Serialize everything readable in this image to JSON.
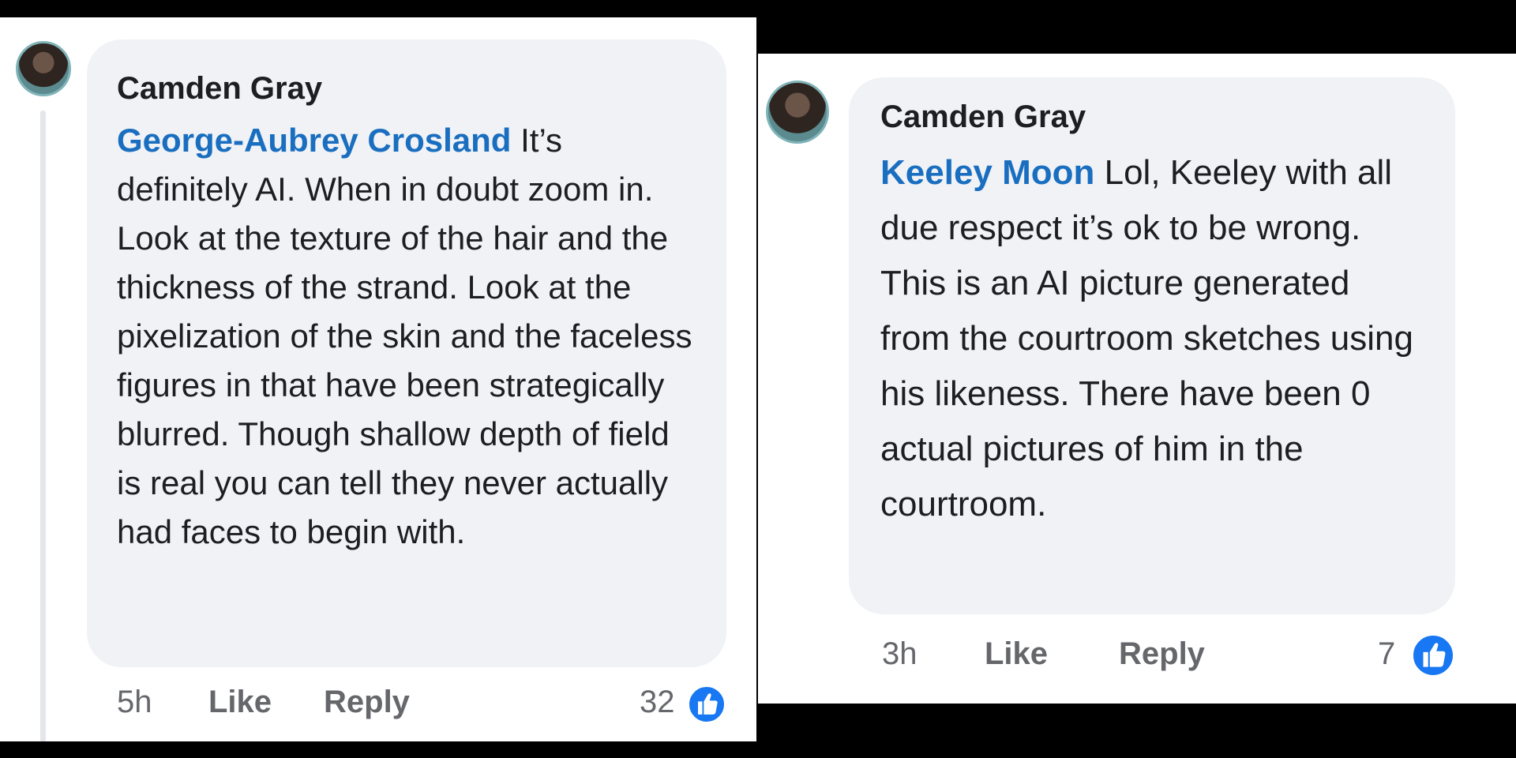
{
  "comments": [
    {
      "author": "Camden Gray",
      "mention": "George-Aubrey Crosland",
      "text": " It’s definitely AI. When in doubt zoom in. Look at the texture of the hair and the thickness of the strand. Look at the pixelization of the skin and the faceless figures in that have been strategically blurred. Though shallow depth of field is real you can tell they never actually had faces to begin with.",
      "time": "5h",
      "like_label": "Like",
      "reply_label": "Reply",
      "reaction_count": "32",
      "reaction_icon": "thumbs-up-icon"
    },
    {
      "author": "Camden Gray",
      "mention": "Keeley Moon",
      "text": " Lol, Keeley with all due respect it’s ok to be wrong. This is an AI picture generated from the courtroom sketches using his likeness. There have been 0 actual pictures of him in the courtroom.",
      "time": "3h",
      "like_label": "Like",
      "reply_label": "Reply",
      "reaction_count": "7",
      "reaction_icon": "thumbs-up-icon"
    }
  ],
  "colors": {
    "mention": "#1a6ec0",
    "bubble": "#f0f2f5",
    "like_badge": "#1877f2"
  }
}
